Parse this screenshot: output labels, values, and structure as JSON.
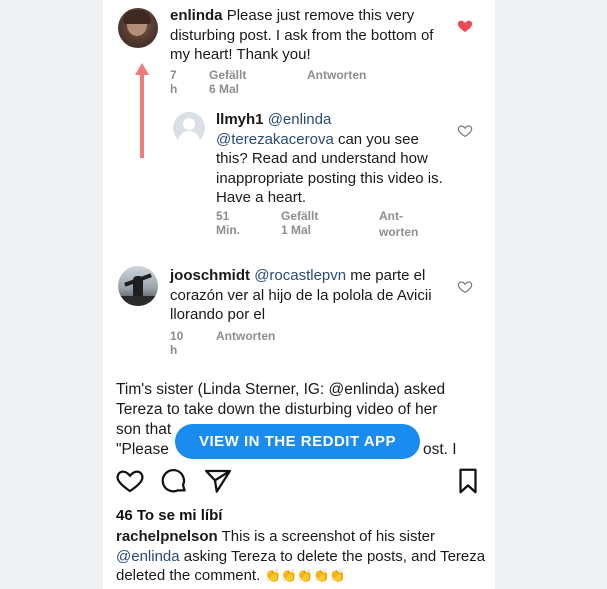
{
  "comments": [
    {
      "username": "enlinda",
      "text": "Please just remove this very disturbing post. I ask from the bottom of my heart! Thank you!",
      "time": "7 h",
      "likes": "Gefällt 6 Mal",
      "reply": "Antworten",
      "liked": true
    },
    {
      "username": "llmyh1",
      "mention1": "@enlinda",
      "mention2": "@terezakacerova",
      "text": "can you see this? Read and understand how inappropriate posting this video is. Have a heart.",
      "time": "51 Min.",
      "likes": "Gefällt 1 Mal",
      "reply_line1": "Ant-",
      "reply_line2": "worten",
      "liked": false
    },
    {
      "username": "jooschmidt",
      "mention": "@rocastlepvn",
      "text": "me parte el corazón ver al hijo de la polola de Avicii llorando por el",
      "time": "10 h",
      "reply": "Antworten",
      "liked": false
    }
  ],
  "caption": {
    "line1": "Tim's sister (Linda Sterner, IG: @enlinda) asked",
    "line2": "Tereza to take down the disturbing video of her",
    "line3a": "son that",
    "line4a": "\"Please",
    "line4b": "ost. I"
  },
  "reddit_button": "VIEW IN THE REDDIT APP",
  "post": {
    "likes": "46 To se mi líbí",
    "username": "rachelpnelson",
    "text_a": "This is a screenshot of his sister",
    "mention": "@enlinda",
    "text_b": "asking Tereza to delete the posts, and",
    "text_c": "Tereza deleted the comment.",
    "emoji": "👏👏👏👏👏"
  },
  "colors": {
    "heart_liked": "#ed4956",
    "arrow": "#ee7a7a",
    "button": "#1a8cf0",
    "mention": "#2b4a7a"
  }
}
